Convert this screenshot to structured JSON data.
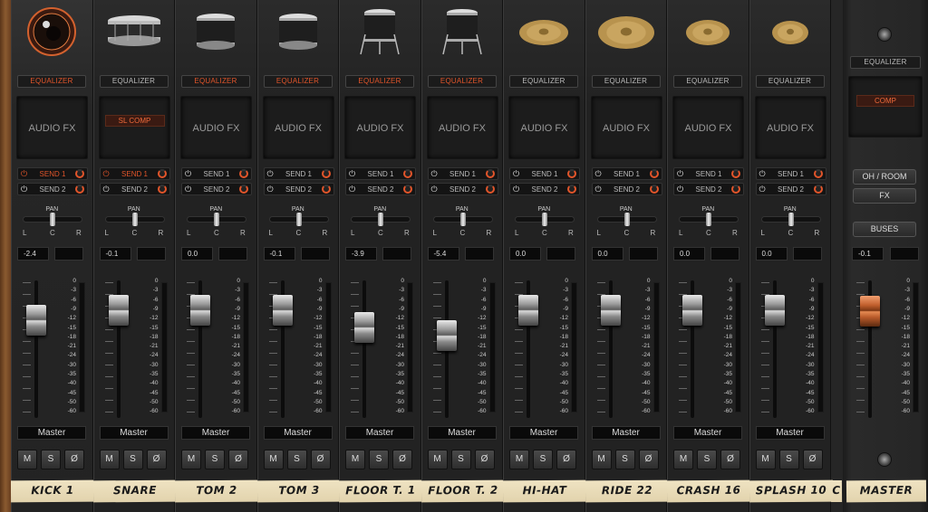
{
  "strip": {
    "eq_label": "EQUALIZER",
    "fx_label": "AUDIO FX",
    "pan_label": "PAN",
    "pan_l": "L",
    "pan_c": "C",
    "pan_r": "R",
    "mute": "M",
    "solo": "S",
    "phase": "Ø",
    "power_glyph": "⏻"
  },
  "scale_values": [
    "0",
    "-3",
    "-6",
    "-9",
    "-12",
    "-15",
    "-18",
    "-21",
    "-24",
    "-30",
    "-35",
    "-40",
    "-45",
    "-50",
    "-60"
  ],
  "channels": [
    {
      "name": "KICK 1",
      "icon": "kick-drum-icon",
      "eq_on": true,
      "fx_slot": "",
      "send1": "SEND 1",
      "send1_on": true,
      "send2": "SEND 2",
      "send2_on": false,
      "volume": "-2.4",
      "pan": 0.5,
      "fader": 0.3,
      "output": "Master",
      "selected": true
    },
    {
      "name": "SNARE",
      "icon": "snare-drum-icon",
      "eq_on": false,
      "fx_slot": "SL COMP",
      "send1": "SEND 1",
      "send1_on": true,
      "send2": "SEND 2",
      "send2_on": false,
      "volume": "-0.1",
      "pan": 0.5,
      "fader": 0.22,
      "output": "Master",
      "selected": false
    },
    {
      "name": "TOM 2",
      "icon": "tom-drum-icon",
      "eq_on": true,
      "fx_slot": "",
      "send1": "SEND 1",
      "send1_on": false,
      "send2": "SEND 2",
      "send2_on": false,
      "volume": "0.0",
      "pan": 0.5,
      "fader": 0.22,
      "output": "Master",
      "selected": false
    },
    {
      "name": "TOM 3",
      "icon": "tom-drum-icon",
      "eq_on": true,
      "fx_slot": "",
      "send1": "SEND 1",
      "send1_on": false,
      "send2": "SEND 2",
      "send2_on": false,
      "volume": "-0.1",
      "pan": 0.5,
      "fader": 0.22,
      "output": "Master",
      "selected": false
    },
    {
      "name": "FLOOR T. 1",
      "icon": "floor-tom-icon",
      "eq_on": true,
      "fx_slot": "",
      "send1": "SEND 1",
      "send1_on": false,
      "send2": "SEND 2",
      "send2_on": false,
      "volume": "-3.9",
      "pan": 0.5,
      "fader": 0.35,
      "output": "Master",
      "selected": false
    },
    {
      "name": "FLOOR T. 2",
      "icon": "floor-tom-icon",
      "eq_on": true,
      "fx_slot": "",
      "send1": "SEND 1",
      "send1_on": false,
      "send2": "SEND 2",
      "send2_on": false,
      "volume": "-5.4",
      "pan": 0.5,
      "fader": 0.41,
      "output": "Master",
      "selected": false
    },
    {
      "name": "HI-HAT",
      "icon": "hihat-cymbal-icon",
      "eq_on": false,
      "fx_slot": "",
      "send1": "SEND 1",
      "send1_on": false,
      "send2": "SEND 2",
      "send2_on": false,
      "volume": "0.0",
      "pan": 0.5,
      "fader": 0.22,
      "output": "Master",
      "selected": false
    },
    {
      "name": "RIDE 22",
      "icon": "ride-cymbal-icon",
      "eq_on": false,
      "fx_slot": "",
      "send1": "SEND 1",
      "send1_on": false,
      "send2": "SEND 2",
      "send2_on": false,
      "volume": "0.0",
      "pan": 0.5,
      "fader": 0.22,
      "output": "Master",
      "selected": false
    },
    {
      "name": "CRASH 16",
      "icon": "crash-cymbal-icon",
      "eq_on": false,
      "fx_slot": "",
      "send1": "SEND 1",
      "send1_on": false,
      "send2": "SEND 2",
      "send2_on": false,
      "volume": "0.0",
      "pan": 0.5,
      "fader": 0.22,
      "output": "Master",
      "selected": false
    },
    {
      "name": "SPLASH 10",
      "icon": "splash-cymbal-icon",
      "eq_on": false,
      "fx_slot": "",
      "send1": "SEND 1",
      "send1_on": false,
      "send2": "SEND 2",
      "send2_on": false,
      "volume": "0.0",
      "pan": 0.5,
      "fader": 0.22,
      "output": "Master",
      "selected": false
    }
  ],
  "partial_tape": "C",
  "master": {
    "name": "MASTER",
    "eq_label": "EQUALIZER",
    "fx_slot": "COMP",
    "oh_room": "OH / ROOM",
    "fx": "FX",
    "buses": "BUSES",
    "volume": "-0.1",
    "fader": 0.23
  },
  "colors": {
    "accent": "#e2552a",
    "panel": "#262626",
    "tape": "#e8dab5"
  }
}
